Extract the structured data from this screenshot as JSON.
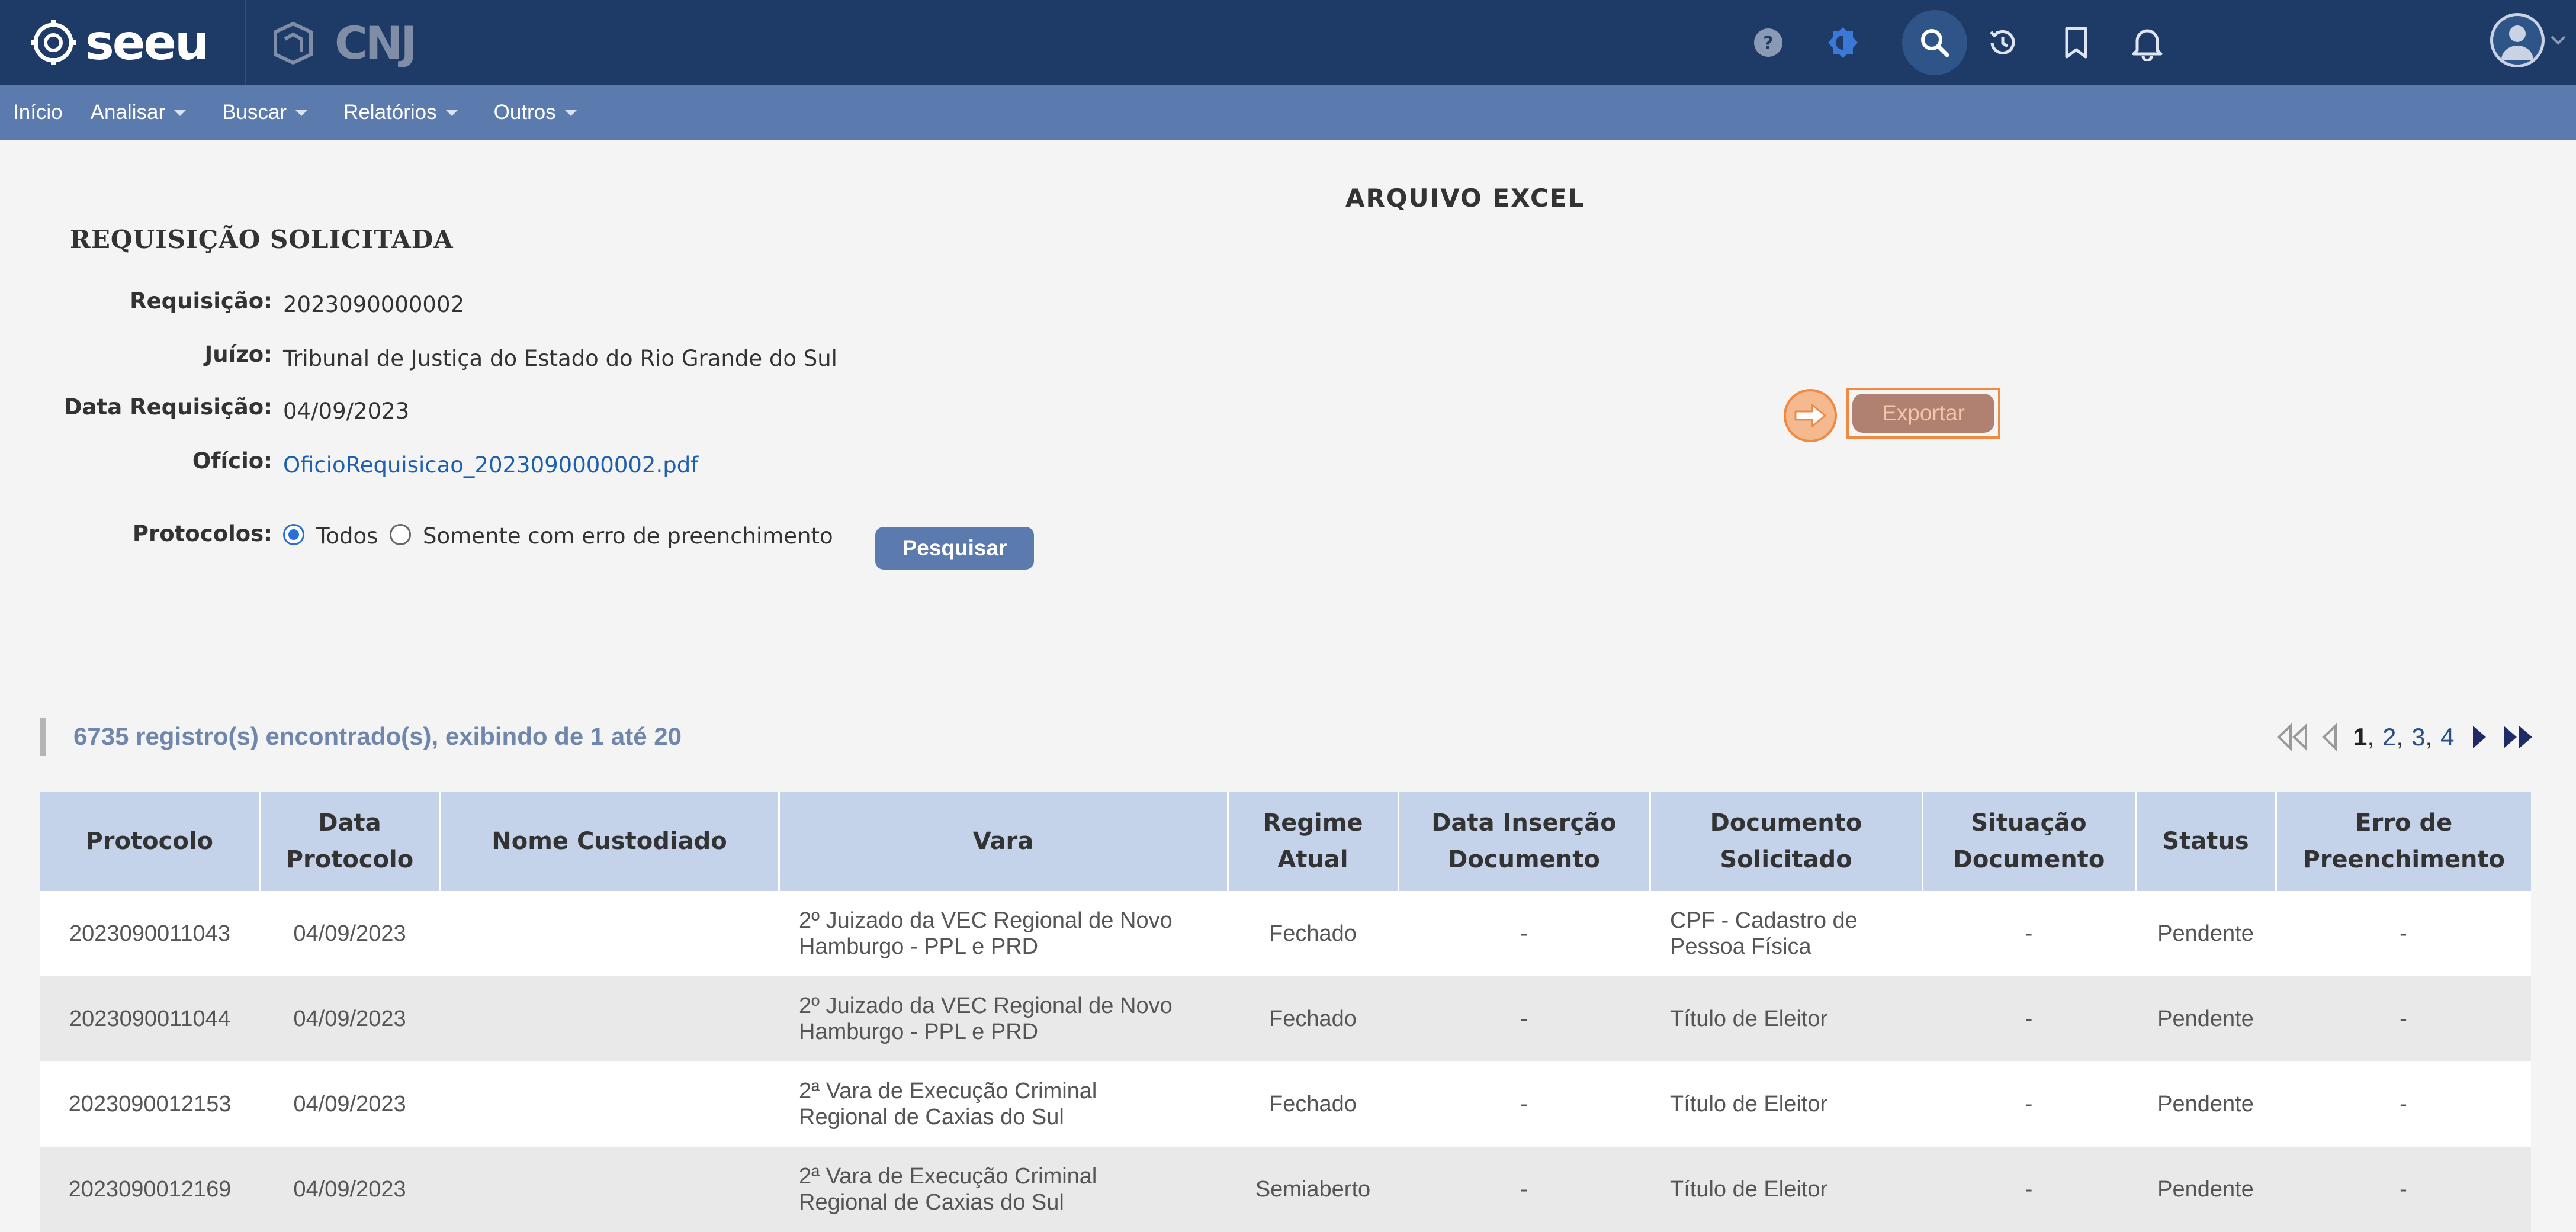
{
  "header": {
    "logo_text": "seeu",
    "partner_text": "CNJ",
    "icons": [
      "help-icon",
      "theme-icon",
      "search-icon",
      "history-icon",
      "bookmark-icon",
      "bell-icon",
      "user-avatar-icon"
    ]
  },
  "menu": {
    "items": [
      {
        "label": "Início",
        "has_dropdown": false
      },
      {
        "label": "Analisar",
        "has_dropdown": true
      },
      {
        "label": "Buscar",
        "has_dropdown": true
      },
      {
        "label": "Relatórios",
        "has_dropdown": true
      },
      {
        "label": "Outros",
        "has_dropdown": true
      }
    ]
  },
  "page": {
    "title": "ARQUIVO EXCEL",
    "section_title": "REQUISIÇÃO SOLICITADA"
  },
  "fields": {
    "requisicao_label": "Requisição:",
    "requisicao_value": "2023090000002",
    "juizo_label": "Juízo:",
    "juizo_value": "Tribunal de Justiça do Estado do Rio Grande do Sul",
    "data_label": "Data Requisição:",
    "data_value": "04/09/2023",
    "oficio_label": "Ofício:",
    "oficio_value": "OficioRequisicao_2023090000002.pdf",
    "protocolos_label": "Protocolos:"
  },
  "filter": {
    "option_all": "Todos",
    "option_errors": "Somente com erro de preenchimento",
    "selected": "Todos",
    "search_button": "Pesquisar"
  },
  "export": {
    "button_label": "Exportar"
  },
  "results": {
    "summary": "6735 registro(s) encontrado(s), exibindo de 1 até 20",
    "pages": [
      "1",
      "2",
      "3",
      "4"
    ],
    "current_page": "1"
  },
  "table": {
    "headers": {
      "protocolo": "Protocolo",
      "data_protocolo_1": "Data",
      "data_protocolo_2": "Protocolo",
      "nome": "Nome Custodiado",
      "vara": "Vara",
      "regime_1": "Regime",
      "regime_2": "Atual",
      "data_insercao_1": "Data Inserção",
      "data_insercao_2": "Documento",
      "documento_1": "Documento",
      "documento_2": "Solicitado",
      "situacao_1": "Situação",
      "situacao_2": "Documento",
      "status": "Status",
      "erro_1": "Erro de",
      "erro_2": "Preenchimento"
    },
    "rows": [
      {
        "protocolo": "2023090011043",
        "data": "04/09/2023",
        "nome": "",
        "vara_1": "2º Juizado da VEC Regional de Novo",
        "vara_2": "Hamburgo - PPL e PRD",
        "regime": "Fechado",
        "data_insercao": "-",
        "documento_1": "CPF - Cadastro de",
        "documento_2": "Pessoa Física",
        "situacao": "-",
        "status": "Pendente",
        "erro": "-"
      },
      {
        "protocolo": "2023090011044",
        "data": "04/09/2023",
        "nome": "",
        "vara_1": "2º Juizado da VEC Regional de Novo",
        "vara_2": "Hamburgo - PPL e PRD",
        "regime": "Fechado",
        "data_insercao": "-",
        "documento_1": "Título de Eleitor",
        "documento_2": "",
        "situacao": "-",
        "status": "Pendente",
        "erro": "-"
      },
      {
        "protocolo": "2023090012153",
        "data": "04/09/2023",
        "nome": "",
        "vara_1": "2ª Vara de Execução Criminal",
        "vara_2": "Regional de Caxias do Sul",
        "regime": "Fechado",
        "data_insercao": "-",
        "documento_1": "Título de Eleitor",
        "documento_2": "",
        "situacao": "-",
        "status": "Pendente",
        "erro": "-"
      },
      {
        "protocolo": "2023090012169",
        "data": "04/09/2023",
        "nome": "",
        "vara_1": "2ª Vara de Execução Criminal",
        "vara_2": "Regional de Caxias do Sul",
        "regime": "Semiaberto",
        "data_insercao": "-",
        "documento_1": "Título de Eleitor",
        "documento_2": "",
        "situacao": "-",
        "status": "Pendente",
        "erro": "-"
      }
    ]
  },
  "colors": {
    "header_bg": "#1e3a66",
    "menu_bg": "#5b7bae",
    "table_header_bg": "#c5d3ea",
    "link": "#1f5fb0",
    "export_highlight": "#ef8a43"
  }
}
